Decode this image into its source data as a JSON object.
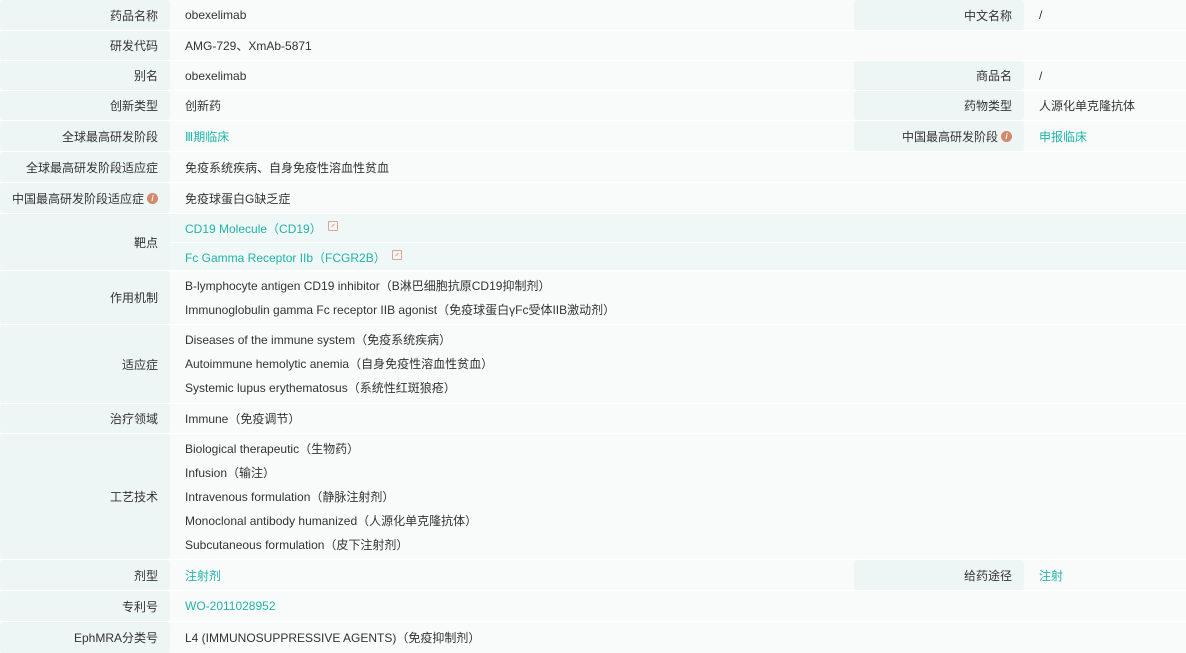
{
  "rows": {
    "name": {
      "label": "药品名称",
      "value": "obexelimab",
      "r_label": "中文名称",
      "r_value": "/"
    },
    "code": {
      "label": "研发代码",
      "value": "AMG-729、XmAb-5871"
    },
    "alias": {
      "label": "别名",
      "value": "obexelimab",
      "r_label": "商品名",
      "r_value": "/"
    },
    "innov": {
      "label": "创新类型",
      "value": "创新药",
      "r_label": "药物类型",
      "r_value": "人源化单克隆抗体"
    },
    "phase": {
      "label": "全球最高研发阶段",
      "value": "Ⅲ期临床",
      "r_label": "中国最高研发阶段",
      "r_value": "申报临床"
    },
    "gind": {
      "label": "全球最高研发阶段适应症",
      "value": "免疫系统疾病、自身免疫性溶血性贫血"
    },
    "cind": {
      "label": "中国最高研发阶段适应症",
      "value": "免疫球蛋白G缺乏症"
    },
    "target": {
      "label": "靶点",
      "items": [
        "CD19 Molecule（CD19）",
        "Fc Gamma Receptor IIb（FCGR2B）"
      ]
    },
    "moa": {
      "label": "作用机制",
      "items": [
        "B-lymphocyte antigen CD19 inhibitor（B淋巴细胞抗原CD19抑制剂）",
        "Immunoglobulin gamma Fc receptor IIB agonist（免疫球蛋白γFc受体IIB激动剂）"
      ]
    },
    "indication": {
      "label": "适应症",
      "items": [
        "Diseases of the immune system（免疫系统疾病）",
        "Autoimmune hemolytic anemia（自身免疫性溶血性贫血）",
        "Systemic lupus erythematosus（系统性红斑狼疮）"
      ]
    },
    "area": {
      "label": "治疗领域",
      "value": "Immune（免疫调节）"
    },
    "tech": {
      "label": "工艺技术",
      "items": [
        "Biological therapeutic（生物药）",
        "Infusion（输注）",
        "Intravenous formulation（静脉注射剂）",
        "Monoclonal antibody humanized（人源化单克隆抗体）",
        "Subcutaneous formulation（皮下注射剂）"
      ]
    },
    "form": {
      "label": "剂型",
      "value": "注射剂",
      "r_label": "给药途径",
      "r_value": "注射"
    },
    "patent": {
      "label": "专利号",
      "value": "WO-2011028952"
    },
    "ephmra": {
      "label": "EphMRA分类号",
      "value": "L4 (IMMUNOSUPPRESSIVE AGENTS)（免疫抑制剂）"
    }
  },
  "colors": {
    "link": "#22b4a7",
    "info": "#d6896a"
  }
}
